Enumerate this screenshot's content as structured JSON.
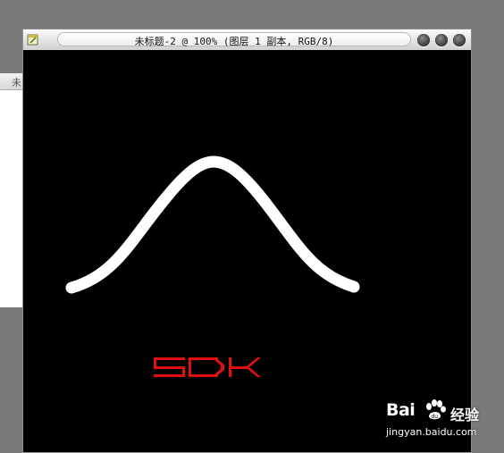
{
  "background_window": {
    "title_fragment": "未"
  },
  "document_window": {
    "title": "未标题-2 @ 100% (图层 1 副本, RGB/8)",
    "canvas": {
      "background": "#000000",
      "curve_color": "#ffffff",
      "logo_text": "SDK",
      "logo_color": "#e01010"
    },
    "buttons": [
      "minimize-button",
      "zoom-button",
      "close-button"
    ]
  },
  "watermark": {
    "brand_bai": "Bai",
    "brand_du": "du",
    "jingyan": "经验",
    "url": "jingyan.baidu.com"
  }
}
